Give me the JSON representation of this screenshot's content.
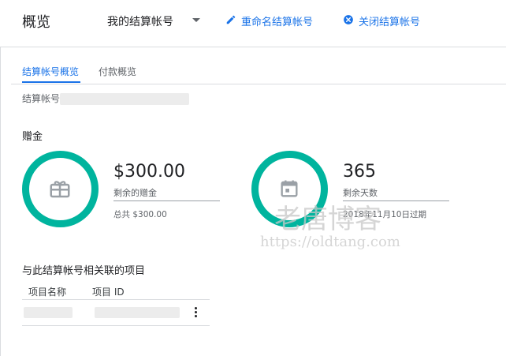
{
  "header": {
    "title": "概览",
    "account_name": "我的结算帐号",
    "rename_label": "重命名结算帐号",
    "close_label": "关闭结算帐号"
  },
  "tabs": [
    {
      "label": "结算帐号概览",
      "active": true
    },
    {
      "label": "付款概览",
      "active": false
    }
  ],
  "account_id_label": "结算帐号",
  "credits": {
    "section_title": "赠金",
    "amount": {
      "value": "$300.00",
      "label": "剩余的赠金",
      "total": "总共 $300.00"
    },
    "days": {
      "value": "365",
      "label": "剩余天数",
      "expiry": "2018年11月10日过期"
    }
  },
  "projects": {
    "section_title": "与此结算帐号相关联的项目",
    "columns": [
      "项目名称",
      "项目 ID"
    ]
  },
  "watermark": {
    "title": "老唐博客",
    "url": "https://oldtang.com"
  },
  "colors": {
    "accent": "#1a73e8",
    "ring": "#00b49e",
    "icon": "#9aa0a6"
  },
  "icons": {
    "rename": "edit-pencil-icon",
    "close": "close-circle-icon",
    "gift": "gift-card-icon",
    "calendar": "calendar-icon",
    "more": "more-vert-icon",
    "dropdown": "caret-down-icon"
  }
}
